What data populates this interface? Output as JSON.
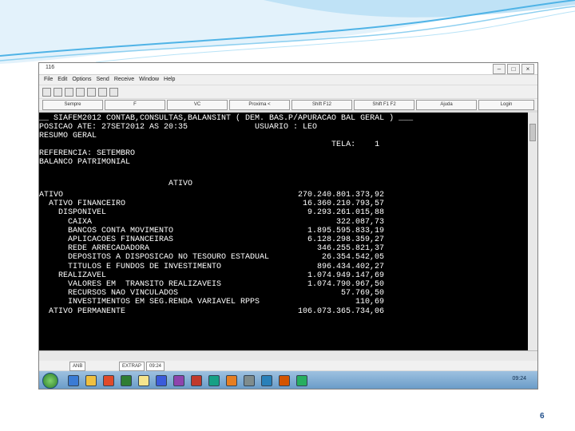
{
  "window": {
    "title": "116"
  },
  "menu": [
    "File",
    "Edit",
    "Options",
    "Send",
    "Receive",
    "Window",
    "Help"
  ],
  "fkeys": [
    "Sempre",
    "F",
    "VC",
    "Proxima <",
    "Shift F12",
    "Shift F1 F2",
    "Ajuda",
    "Login"
  ],
  "terminal": {
    "lines": [
      "__ SIAFEM2012 CONTAB,CONSULTAS,BALANSINT ( DEM. BAS.P/APURACAO BAL GERAL ) ___",
      "POSICAO ATE: 27SET2012 AS 20:35              USUARIO : LEO",
      "RESUMO GERAL",
      "                                                             TELA:    1",
      "REFERENCIA: SETEMBRO",
      "BALANCO PATRIMONIAL",
      "",
      "                           ATIVO"
    ],
    "rows": [
      {
        "label": "ATIVO",
        "value": "270.240.801.373,92"
      },
      {
        "label": "  ATIVO FINANCEIRO",
        "value": "16.360.210.793,57"
      },
      {
        "label": "    DISPONIVEL",
        "value": "9.293.261.015,88"
      },
      {
        "label": "      CAIXA",
        "value": "322.087,73"
      },
      {
        "label": "      BANCOS CONTA MOVIMENTO",
        "value": "1.895.595.833,19"
      },
      {
        "label": "      APLICACOES FINANCEIRAS",
        "value": "6.128.298.359,27"
      },
      {
        "label": "      REDE ARRECADADORA",
        "value": "346.255.821,37"
      },
      {
        "label": "      DEPOSITOS A DISPOSICAO NO TESOURO ESTADUAL",
        "value": "26.354.542,05"
      },
      {
        "label": "      TITULOS E FUNDOS DE INVESTIMENTO",
        "value": "896.434.402,27"
      },
      {
        "label": "    REALIZAVEL",
        "value": "1.074.949.147,69"
      },
      {
        "label": "      VALORES EM  TRANSITO REALIZAVEIS",
        "value": "1.074.790.967,50"
      },
      {
        "label": "      RECURSOS NAO VINCULADOS",
        "value": "57.769,50"
      },
      {
        "label": "      INVESTIMENTOS EM SEG.RENDA VARIAVEL RPPS",
        "value": "110,69"
      },
      {
        "label": "  ATIVO PERMANENTE",
        "value": "106.073.365.734,06"
      }
    ]
  },
  "status": {
    "session": "ANB",
    "mode": "EXTRAP",
    "time": "09:24"
  },
  "taskbar": {
    "clock": "09:24"
  },
  "slide": {
    "page_number": "6"
  },
  "colors": {
    "terminal_bg": "#000000",
    "terminal_fg": "#ffffff",
    "accent": "#1f4e8a"
  }
}
